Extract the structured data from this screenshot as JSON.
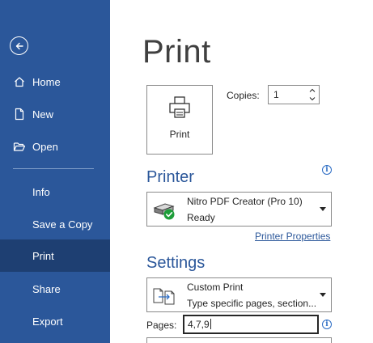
{
  "sidebar": {
    "back_label": "Back",
    "items": [
      {
        "label": "Home",
        "icon": "home-icon"
      },
      {
        "label": "New",
        "icon": "new-document-icon"
      },
      {
        "label": "Open",
        "icon": "folder-open-icon"
      },
      {
        "label": "Info"
      },
      {
        "label": "Save a Copy"
      },
      {
        "label": "Print"
      },
      {
        "label": "Share"
      },
      {
        "label": "Export"
      }
    ],
    "active_item": "Print",
    "background": "#2b579a",
    "active_background": "#1e3f72"
  },
  "main": {
    "title": "Print",
    "print_button_label": "Print",
    "copies_label": "Copies:",
    "copies_value": "1",
    "printer": {
      "heading": "Printer",
      "name": "Nitro PDF Creator (Pro 10)",
      "status": "Ready",
      "properties_link": "Printer Properties"
    },
    "settings": {
      "heading": "Settings",
      "mode_title": "Custom Print",
      "mode_desc": "Type specific pages, section...",
      "pages_label": "Pages:",
      "pages_value": "4,7,9"
    },
    "accent": "#2b579a"
  }
}
